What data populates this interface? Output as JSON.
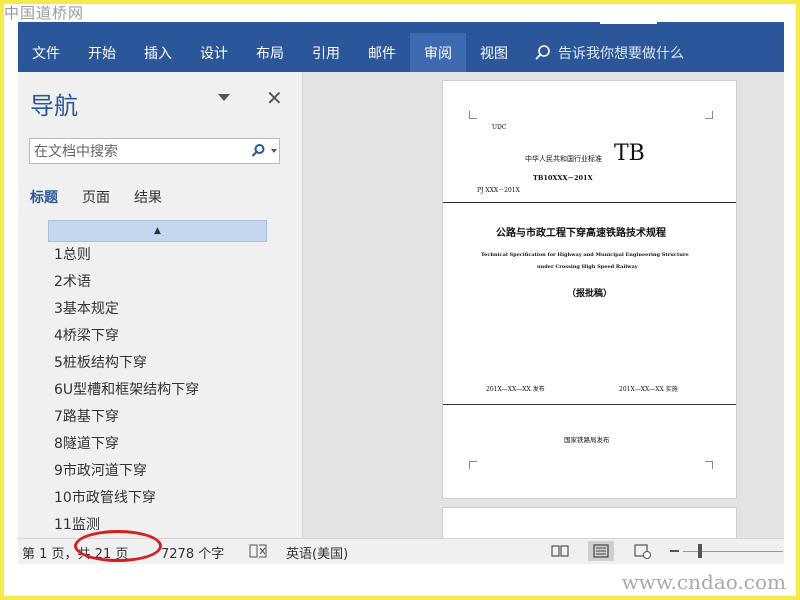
{
  "watermark": {
    "top": "中国道桥网",
    "bottom": "www.cndao.com"
  },
  "ribbon": {
    "tabs": [
      {
        "label": "文件"
      },
      {
        "label": "开始"
      },
      {
        "label": "插入"
      },
      {
        "label": "设计"
      },
      {
        "label": "布局"
      },
      {
        "label": "引用"
      },
      {
        "label": "邮件"
      },
      {
        "label": "审阅"
      },
      {
        "label": "视图"
      }
    ],
    "active_tab": "审阅",
    "tell_me": "告诉我你想要做什么",
    "color": "#2b579a"
  },
  "nav": {
    "title": "导航",
    "search_placeholder": "在文档中搜索",
    "tabs": [
      {
        "label": "标题"
      },
      {
        "label": "页面"
      },
      {
        "label": "结果"
      }
    ],
    "active_tab": "标题",
    "collapse_glyph": "▲",
    "headings": [
      "1总则",
      "2术语",
      "3基本规定",
      "4桥梁下穿",
      "5桩板结构下穿",
      "6U型槽和框架结构下穿",
      "7路基下穿",
      "8隧道下穿",
      "9市政河道下穿",
      "10市政管线下穿",
      "11监测"
    ]
  },
  "document": {
    "udc": "UDC",
    "header_std": "中华人民共和国行业标准",
    "tb": "TB",
    "code": "TB10XXX－201X",
    "pj": "PJ XXX－201X",
    "title_cn": "公路与市政工程下穿高速铁路技术规程",
    "title_en_1": "Technical Specification for Highway and Municipal Engineering Structure",
    "title_en_2": "under Crossing High Speed Railway",
    "stage": "（报批稿）",
    "publish_date": "201X—XX—XX  发布",
    "implement_date": "201X—XX—XX  实施",
    "publisher": "国家铁路局发布"
  },
  "status": {
    "page": "第 1 页，共 21 页",
    "words": "7278 个字",
    "language": "英语(美国)"
  }
}
